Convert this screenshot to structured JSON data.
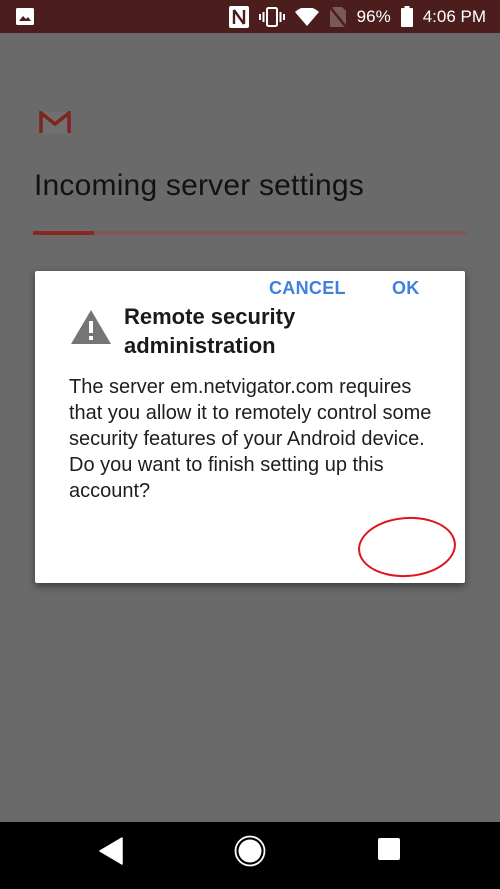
{
  "status_bar": {
    "notification_icon": "image-icon",
    "icons": [
      "nfc-icon",
      "vibrate-icon",
      "wifi-icon",
      "no-sim-icon"
    ],
    "battery_percent": "96%",
    "battery_icon": "battery-icon",
    "time": "4:06 PM"
  },
  "app": {
    "logo_icon": "gmail-icon",
    "title": "Incoming server settings",
    "progress_percent": 14,
    "colors": {
      "accent": "#8b2521",
      "track": "#7e5854"
    }
  },
  "dialog": {
    "icon": "warning-icon",
    "title": "Remote security administration",
    "body": "The server em.netvigator.com requires that you allow it to remotely control some security features of your Android device. Do you want to finish setting up this account?",
    "buttons": {
      "cancel": "CANCEL",
      "ok": "OK"
    },
    "button_color": "#3f7fe0",
    "highlight_color": "#e0141a"
  },
  "nav_bar": {
    "back": "back-icon",
    "home": "home-icon",
    "recents": "recents-icon"
  }
}
